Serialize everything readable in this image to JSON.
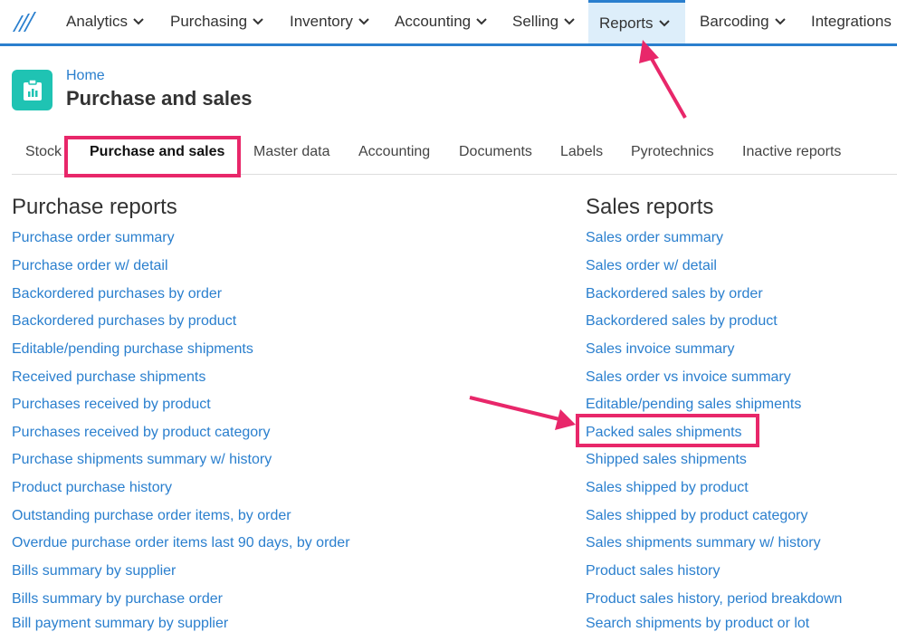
{
  "nav": {
    "items": [
      {
        "label": "Analytics"
      },
      {
        "label": "Purchasing"
      },
      {
        "label": "Inventory"
      },
      {
        "label": "Accounting"
      },
      {
        "label": "Selling"
      },
      {
        "label": "Reports"
      },
      {
        "label": "Barcoding"
      },
      {
        "label": "Integrations"
      }
    ],
    "active": "Reports"
  },
  "header": {
    "breadcrumb": "Home",
    "title": "Purchase and sales",
    "icon": "clipboard-chart-icon"
  },
  "tabs": [
    {
      "label": "Stock"
    },
    {
      "label": "Purchase and sales"
    },
    {
      "label": "Master data"
    },
    {
      "label": "Accounting"
    },
    {
      "label": "Documents"
    },
    {
      "label": "Labels"
    },
    {
      "label": "Pyrotechnics"
    },
    {
      "label": "Inactive reports"
    }
  ],
  "purchase": {
    "title": "Purchase reports",
    "links": [
      "Purchase order summary",
      "Purchase order w/ detail",
      "Backordered purchases by order",
      "Backordered purchases by product",
      "Editable/pending purchase shipments",
      "Received purchase shipments",
      "Purchases received by product",
      "Purchases received by product category",
      "Purchase shipments summary w/ history",
      "Product purchase history",
      "Outstanding purchase order items, by order",
      "Overdue purchase order items last 90 days, by order",
      "Bills summary by supplier",
      "Bills summary by purchase order",
      "Bill payment summary by supplier"
    ]
  },
  "sales": {
    "title": "Sales reports",
    "links": [
      "Sales order summary",
      "Sales order w/ detail",
      "Backordered sales by order",
      "Backordered sales by product",
      "Sales invoice summary",
      "Sales order vs invoice summary",
      "Editable/pending sales shipments",
      "Packed sales shipments",
      "Shipped sales shipments",
      "Sales shipped by product",
      "Sales shipped by product category",
      "Sales shipments summary w/ history",
      "Product sales history",
      "Product sales history, period breakdown",
      "Search shipments by product or lot"
    ]
  },
  "colors": {
    "accent": "#2a7fce",
    "highlight": "#e8276a",
    "icon_bg": "#1fc3b3"
  }
}
